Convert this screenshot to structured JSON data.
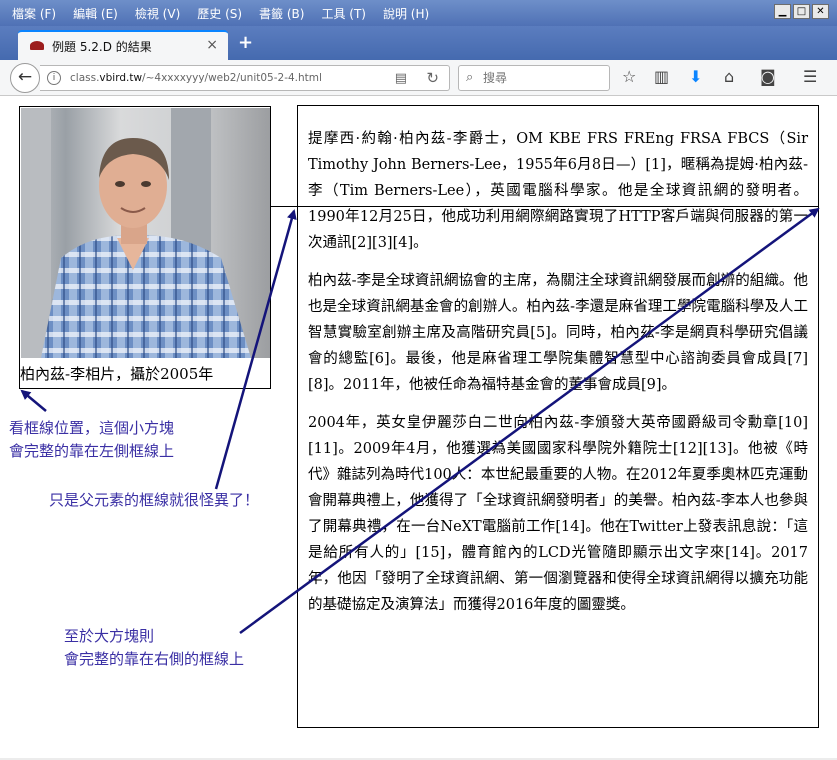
{
  "menubar": {
    "items": [
      "檔案 (F)",
      "編輯 (E)",
      "檢視 (V)",
      "歷史 (S)",
      "書籤 (B)",
      "工具 (T)",
      "說明 (H)"
    ]
  },
  "tab": {
    "title": "例題 5.2.D 的結果",
    "close": "×",
    "new_tab": "+"
  },
  "nav": {
    "url_prefix": "class.",
    "url_domain": "vbird.tw",
    "url_path": "/~4xxxxyyy/web2/unit05-2-4.html",
    "search_placeholder": "搜尋"
  },
  "small_box": {
    "caption": "柏內茲-李相片，攝於2005年"
  },
  "big_box": {
    "paragraphs": [
      "提摩西·約翰·柏內茲-李爵士，OM KBE FRS FREng FRSA FBCS（Sir Timothy John Berners-Lee，1955年6月8日—）[1]，暱稱為提姆·柏內茲-李（Tim Berners-Lee），英國電腦科學家。他是全球資訊網的發明者。1990年12月25日，他成功利用網際網路實現了HTTP客戶端與伺服器的第一次通訊[2][3][4]。",
      "柏內茲-李是全球資訊網協會的主席，為關注全球資訊網發展而創辦的組織。他也是全球資訊網基金會的創辦人。柏內茲-李還是麻省理工學院電腦科學及人工智慧實驗室創辦主席及高階研究員[5]。同時，柏內茲-李是網頁科學研究倡議會的總監[6]。最後，他是麻省理工學院集體智慧型中心諮詢委員會成員[7][8]。2011年，他被任命為福特基金會的董事會成員[9]。",
      "2004年，英女皇伊麗莎白二世向柏內茲-李頒發大英帝國爵級司令勳章[10][11]。2009年4月，他獲選為美國國家科學院外籍院士[12][13]。他被《時代》雜誌列為時代100人：本世紀最重要的人物。在2012年夏季奧林匹克運動會開幕典禮上，他獲得了「全球資訊網發明者」的美譽。柏內茲-李本人也參與了開幕典禮，在一台NeXT電腦前工作[14]。他在Twitter上發表訊息說：「這是給所有人的」[15]，體育館內的LCD光管隨即顯示出文字來[14]。2017年，他因「發明了全球資訊網、第一個瀏覽器和使得全球資訊網得以擴充功能的基礎協定及演算法」而獲得2016年度的圖靈獎。"
    ]
  },
  "annotations": {
    "small_line1": "看框線位置，這個小方塊",
    "small_line2": "會完整的靠在左側框線上",
    "parent": "只是父元素的框線就很怪異了！",
    "big_line1": "至於大方塊則",
    "big_line2": "會完整的靠在右側的框線上"
  },
  "colors": {
    "annotation": "#3a2fa4",
    "arrow": "#14147a",
    "menubar": "#5a7bbf"
  }
}
